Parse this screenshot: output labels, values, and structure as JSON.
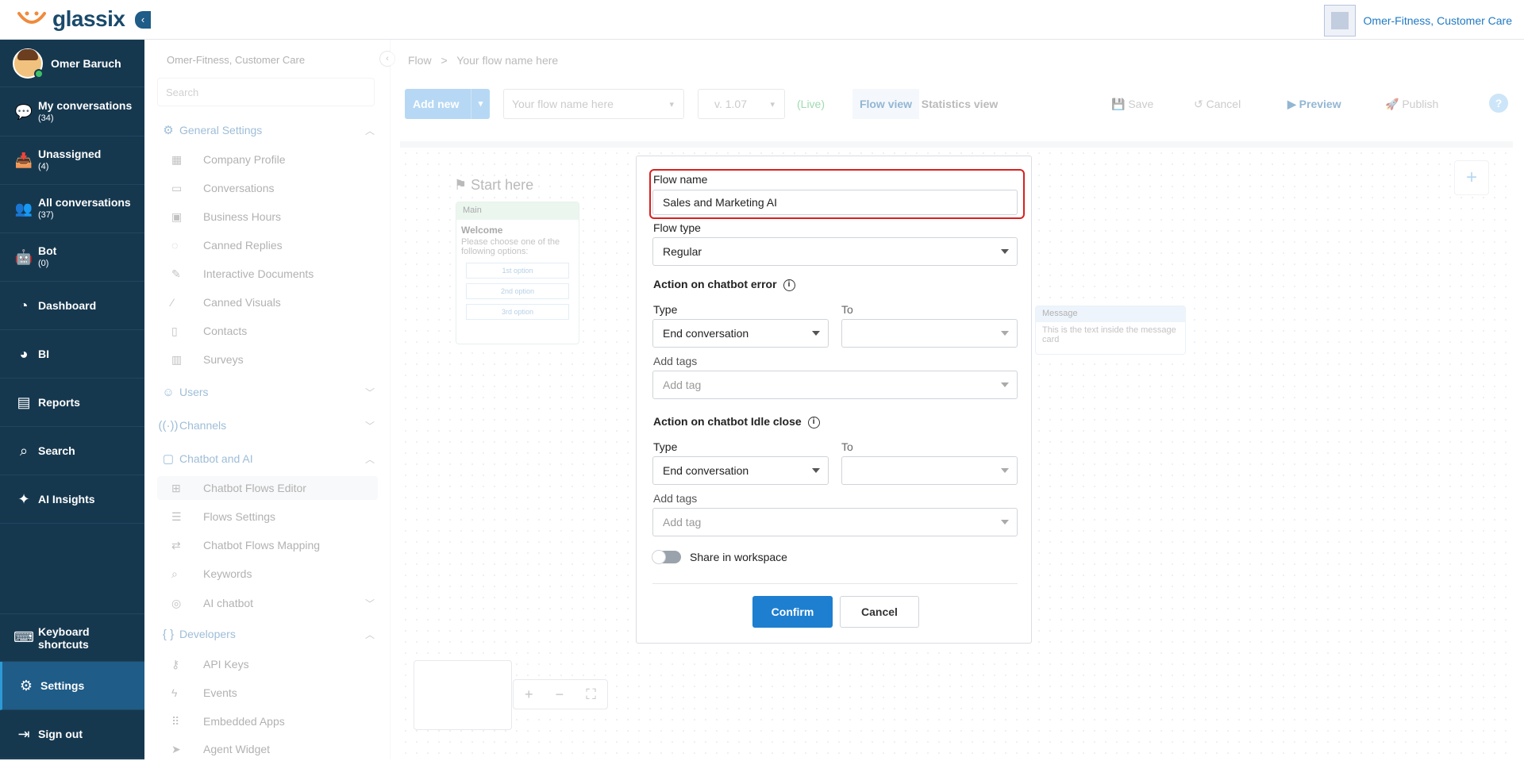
{
  "app": {
    "logo": "glassix",
    "workspace": "Omer-Fitness, Customer Care"
  },
  "nav": {
    "user": "Omer Baruch",
    "items": [
      {
        "label": "My conversations",
        "count": "(34)",
        "icon": "chat-icon"
      },
      {
        "label": "Unassigned",
        "count": "(4)",
        "icon": "inbox-icon"
      },
      {
        "label": "All conversations",
        "count": "(37)",
        "icon": "people-icon"
      },
      {
        "label": "Bot",
        "count": "(0)",
        "icon": "robot-icon"
      },
      {
        "label": "Dashboard",
        "count": "",
        "icon": "dashboard-icon"
      },
      {
        "label": "BI",
        "count": "",
        "icon": "pie-icon"
      },
      {
        "label": "Reports",
        "count": "",
        "icon": "document-icon"
      },
      {
        "label": "Search",
        "count": "",
        "icon": "search-icon"
      },
      {
        "label": "AI Insights",
        "count": "",
        "icon": "sparkle-icon"
      }
    ],
    "bottom": [
      {
        "label": "Keyboard shortcuts",
        "icon": "keyboard-icon"
      },
      {
        "label": "Settings",
        "icon": "gear-icon"
      },
      {
        "label": "Sign out",
        "icon": "signout-icon"
      }
    ]
  },
  "settings": {
    "workspace": "Omer-Fitness, Customer Care",
    "search_placeholder": "Search",
    "general": "General Settings",
    "general_items": [
      "Company Profile",
      "Conversations",
      "Business Hours",
      "Canned Replies",
      "Interactive Documents",
      "Canned Visuals",
      "Contacts",
      "Surveys"
    ],
    "users": "Users",
    "channels": "Channels",
    "chatbot": "Chatbot and AI",
    "chatbot_items": [
      "Chatbot Flows Editor",
      "Flows Settings",
      "Chatbot Flows Mapping",
      "Keywords",
      "AI chatbot"
    ],
    "developers": "Developers",
    "developer_items": [
      "API Keys",
      "Events",
      "Embedded Apps",
      "Agent Widget"
    ]
  },
  "editor": {
    "breadcrumb_root": "Flow",
    "breadcrumb_sep": ">",
    "breadcrumb_current": "Your flow name here",
    "add_new": "Add new",
    "flow_select": "Your flow name here",
    "version": "v. 1.07",
    "live": "(Live)",
    "flow_view": "Flow view",
    "statistics_view": "Statistics view",
    "save": "Save",
    "cancel": "Cancel",
    "preview": "Preview",
    "publish": "Publish",
    "help": "?",
    "start_here": "Start here",
    "main_card": {
      "title": "Main",
      "heading": "Welcome",
      "text": "Please choose one of the following options:",
      "options": [
        "1st option",
        "2nd option",
        "3rd option"
      ]
    },
    "message_card": {
      "title": "Message",
      "text": "This is the text inside the message card"
    }
  },
  "modal": {
    "flow_name_label": "Flow name",
    "flow_name_value": "Sales and Marketing AI",
    "flow_type_label": "Flow type",
    "flow_type_value": "Regular",
    "error_section": "Action on chatbot error",
    "type_label": "Type",
    "to_label": "To",
    "error_type_value": "End conversation",
    "add_tags_label": "Add tags",
    "add_tag_placeholder": "Add tag",
    "idle_section": "Action on chatbot Idle close",
    "idle_type_value": "End conversation",
    "share_label": "Share in workspace",
    "confirm": "Confirm",
    "cancel": "Cancel"
  },
  "colors": {
    "nav_bg": "#16384f",
    "nav_active": "#1f5c87",
    "primary": "#1e7fd0",
    "highlight_border": "#d92020"
  }
}
